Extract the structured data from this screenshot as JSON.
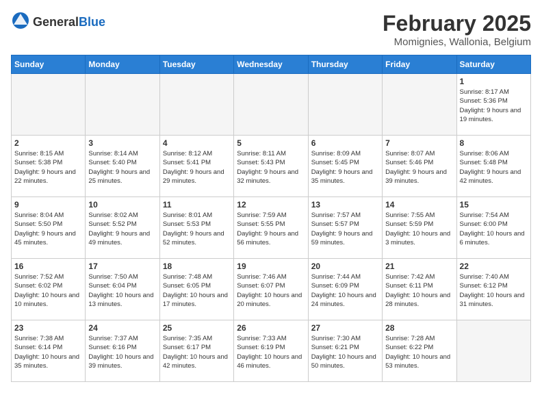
{
  "header": {
    "logo": {
      "text_general": "General",
      "text_blue": "Blue"
    },
    "title": "February 2025",
    "location": "Momignies, Wallonia, Belgium"
  },
  "weekdays": [
    "Sunday",
    "Monday",
    "Tuesday",
    "Wednesday",
    "Thursday",
    "Friday",
    "Saturday"
  ],
  "weeks": [
    [
      {
        "day": "",
        "empty": true
      },
      {
        "day": "",
        "empty": true
      },
      {
        "day": "",
        "empty": true
      },
      {
        "day": "",
        "empty": true
      },
      {
        "day": "",
        "empty": true
      },
      {
        "day": "",
        "empty": true
      },
      {
        "day": "1",
        "sunrise": "8:17 AM",
        "sunset": "5:36 PM",
        "daylight": "9 hours and 19 minutes."
      }
    ],
    [
      {
        "day": "2",
        "sunrise": "8:15 AM",
        "sunset": "5:38 PM",
        "daylight": "9 hours and 22 minutes."
      },
      {
        "day": "3",
        "sunrise": "8:14 AM",
        "sunset": "5:40 PM",
        "daylight": "9 hours and 25 minutes."
      },
      {
        "day": "4",
        "sunrise": "8:12 AM",
        "sunset": "5:41 PM",
        "daylight": "9 hours and 29 minutes."
      },
      {
        "day": "5",
        "sunrise": "8:11 AM",
        "sunset": "5:43 PM",
        "daylight": "9 hours and 32 minutes."
      },
      {
        "day": "6",
        "sunrise": "8:09 AM",
        "sunset": "5:45 PM",
        "daylight": "9 hours and 35 minutes."
      },
      {
        "day": "7",
        "sunrise": "8:07 AM",
        "sunset": "5:46 PM",
        "daylight": "9 hours and 39 minutes."
      },
      {
        "day": "8",
        "sunrise": "8:06 AM",
        "sunset": "5:48 PM",
        "daylight": "9 hours and 42 minutes."
      }
    ],
    [
      {
        "day": "9",
        "sunrise": "8:04 AM",
        "sunset": "5:50 PM",
        "daylight": "9 hours and 45 minutes."
      },
      {
        "day": "10",
        "sunrise": "8:02 AM",
        "sunset": "5:52 PM",
        "daylight": "9 hours and 49 minutes."
      },
      {
        "day": "11",
        "sunrise": "8:01 AM",
        "sunset": "5:53 PM",
        "daylight": "9 hours and 52 minutes."
      },
      {
        "day": "12",
        "sunrise": "7:59 AM",
        "sunset": "5:55 PM",
        "daylight": "9 hours and 56 minutes."
      },
      {
        "day": "13",
        "sunrise": "7:57 AM",
        "sunset": "5:57 PM",
        "daylight": "9 hours and 59 minutes."
      },
      {
        "day": "14",
        "sunrise": "7:55 AM",
        "sunset": "5:59 PM",
        "daylight": "10 hours and 3 minutes."
      },
      {
        "day": "15",
        "sunrise": "7:54 AM",
        "sunset": "6:00 PM",
        "daylight": "10 hours and 6 minutes."
      }
    ],
    [
      {
        "day": "16",
        "sunrise": "7:52 AM",
        "sunset": "6:02 PM",
        "daylight": "10 hours and 10 minutes."
      },
      {
        "day": "17",
        "sunrise": "7:50 AM",
        "sunset": "6:04 PM",
        "daylight": "10 hours and 13 minutes."
      },
      {
        "day": "18",
        "sunrise": "7:48 AM",
        "sunset": "6:05 PM",
        "daylight": "10 hours and 17 minutes."
      },
      {
        "day": "19",
        "sunrise": "7:46 AM",
        "sunset": "6:07 PM",
        "daylight": "10 hours and 20 minutes."
      },
      {
        "day": "20",
        "sunrise": "7:44 AM",
        "sunset": "6:09 PM",
        "daylight": "10 hours and 24 minutes."
      },
      {
        "day": "21",
        "sunrise": "7:42 AM",
        "sunset": "6:11 PM",
        "daylight": "10 hours and 28 minutes."
      },
      {
        "day": "22",
        "sunrise": "7:40 AM",
        "sunset": "6:12 PM",
        "daylight": "10 hours and 31 minutes."
      }
    ],
    [
      {
        "day": "23",
        "sunrise": "7:38 AM",
        "sunset": "6:14 PM",
        "daylight": "10 hours and 35 minutes."
      },
      {
        "day": "24",
        "sunrise": "7:37 AM",
        "sunset": "6:16 PM",
        "daylight": "10 hours and 39 minutes."
      },
      {
        "day": "25",
        "sunrise": "7:35 AM",
        "sunset": "6:17 PM",
        "daylight": "10 hours and 42 minutes."
      },
      {
        "day": "26",
        "sunrise": "7:33 AM",
        "sunset": "6:19 PM",
        "daylight": "10 hours and 46 minutes."
      },
      {
        "day": "27",
        "sunrise": "7:30 AM",
        "sunset": "6:21 PM",
        "daylight": "10 hours and 50 minutes."
      },
      {
        "day": "28",
        "sunrise": "7:28 AM",
        "sunset": "6:22 PM",
        "daylight": "10 hours and 53 minutes."
      },
      {
        "day": "",
        "empty": true
      }
    ]
  ]
}
